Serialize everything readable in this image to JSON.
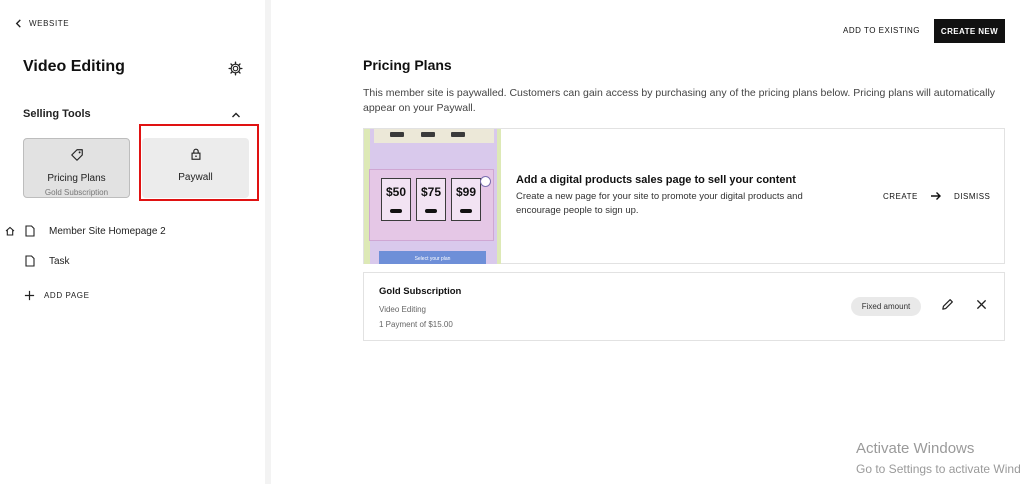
{
  "sidebar": {
    "back_label": "WEBSITE",
    "site_title": "Video Editing",
    "section_label": "Selling Tools",
    "tools": [
      {
        "label": "Pricing Plans",
        "sub": "Gold Subscription"
      },
      {
        "label": "Paywall"
      }
    ],
    "pages": [
      {
        "label": "Member Site Homepage 2",
        "is_home": true
      },
      {
        "label": "Task",
        "is_home": false
      }
    ],
    "add_page_label": "ADD PAGE"
  },
  "header": {
    "add_existing_label": "ADD TO EXISTING",
    "create_new_label": "CREATE NEW"
  },
  "main": {
    "title": "Pricing Plans",
    "description": "This member site is paywalled. Customers can gain access by purchasing any of the pricing plans below. Pricing plans will automatically appear on your Paywall.",
    "promo": {
      "title": "Add a digital products sales page to sell your content",
      "description": "Create a new page for your site to promote your digital products and encourage people to sign up.",
      "create_label": "CREATE",
      "dismiss_label": "DISMISS",
      "image_prices": [
        "$50",
        "$75",
        "$99"
      ],
      "image_footer": "Select your plan"
    },
    "plan": {
      "name": "Gold Subscription",
      "site": "Video Editing",
      "payment": "1 Payment of $15.00",
      "badge": "Fixed amount"
    }
  },
  "watermark": {
    "line1": "Activate Windows",
    "line2": "Go to Settings to activate Wind"
  },
  "colors": {
    "highlight": "#e01212",
    "primary_button": "#111111"
  }
}
